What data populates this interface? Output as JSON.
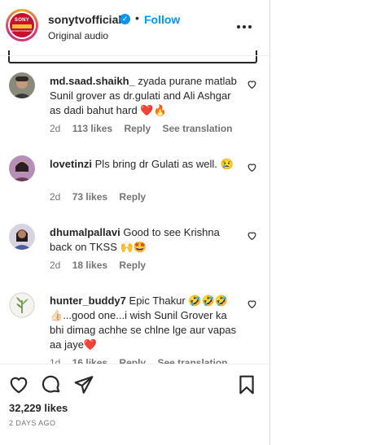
{
  "post": {
    "username": "sonytvofficial",
    "verified_mark": "✓",
    "separator": "•",
    "follow_label": "Follow",
    "audio": "Original audio",
    "more_label": "•••",
    "logo_top": "SONY",
    "logo_bottom": "ENTERTAINMENT"
  },
  "comments": [
    {
      "username": "md.saad.shaikh_",
      "text": "zyada purane matlab Sunil grover as dr.gulati and Ali Ashgar as dadi bahut hard",
      "emoji": "❤️🔥",
      "age": "2d",
      "likes": "113 likes",
      "reply": "Reply",
      "translate": "See translation"
    },
    {
      "username": "lovetinzi",
      "text": "Pls bring dr Gulati as well.",
      "emoji": "😢",
      "age": "2d",
      "likes": "73 likes",
      "reply": "Reply"
    },
    {
      "username": "dhumalpallavi",
      "text": "Good to see Krishna back on TKSS",
      "emoji": "🙌🤩",
      "age": "2d",
      "likes": "18 likes",
      "reply": "Reply"
    },
    {
      "username": "hunter_buddy7",
      "text_1": "Epic Thakur",
      "emoji_1": "🤣🤣🤣👍🏻",
      "text_2": "...good one...i wish Sunil Grover ka bhi dimag achhe se chlne lge aur vapas aa jaye",
      "emoji_2": "❤️",
      "age": "1d",
      "likes": "16 likes",
      "reply": "Reply",
      "translate": "See translation"
    }
  ],
  "footer": {
    "likes": "32,229 likes",
    "date": "2 DAYS AGO"
  },
  "colors": {
    "link": "#0095f6",
    "muted": "#737373",
    "text": "#262626",
    "heart": "#ed4956"
  },
  "icons": {
    "like": "heart-outline-icon",
    "comment": "speech-bubble-icon",
    "share": "paper-plane-icon",
    "save": "bookmark-icon"
  }
}
